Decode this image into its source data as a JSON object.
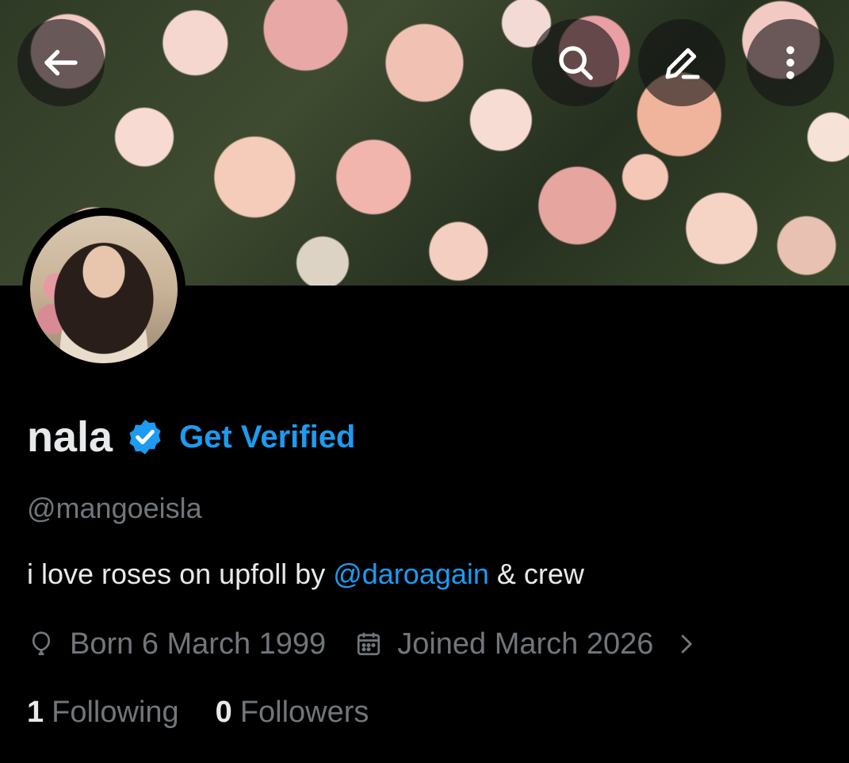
{
  "header": {
    "back_icon": "arrow-left-icon",
    "search_icon": "search-icon",
    "edit_icon": "pencil-icon",
    "more_icon": "more-vertical-icon"
  },
  "profile": {
    "display_name": "nala",
    "verified_link": "Get Verified",
    "handle": "@mangoeisla",
    "bio": {
      "text_before": "i love roses on upfoll by ",
      "mention": "@daroagain",
      "text_after": " & crew"
    },
    "birthday": "Born 6 March 1999",
    "joined": "Joined March 2026",
    "following_count": "1",
    "following_label": "Following",
    "followers_count": "0",
    "followers_label": "Followers"
  },
  "colors": {
    "accent": "#1d9bf0",
    "text_primary": "#e7e9ea",
    "text_secondary": "#71767b",
    "background": "#000000"
  }
}
